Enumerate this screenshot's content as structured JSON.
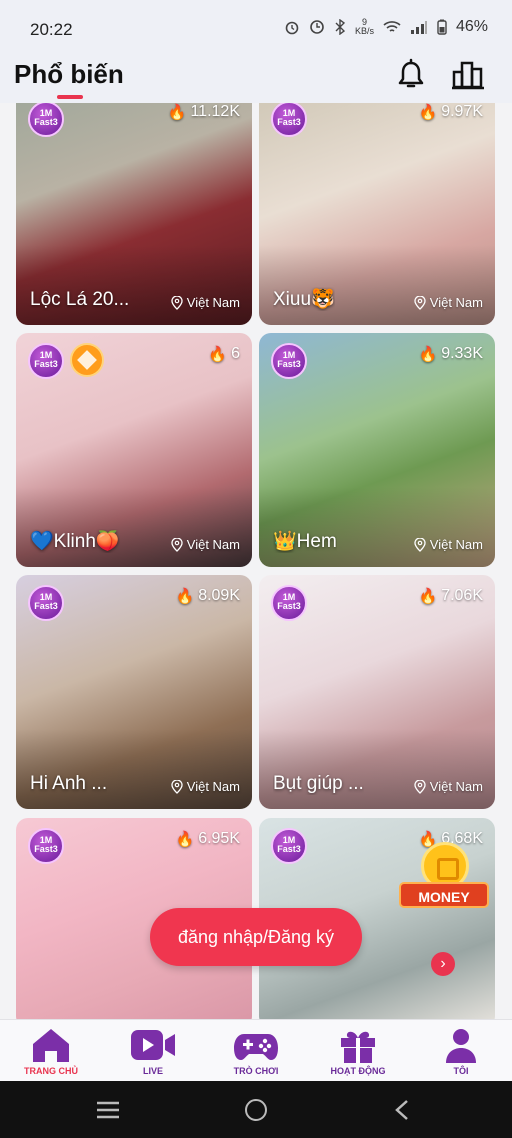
{
  "status_bar": {
    "time": "20:22",
    "net_speed": "9",
    "net_unit": "KB/s",
    "battery": "46%"
  },
  "header": {
    "title": "Phổ biến"
  },
  "cards": [
    {
      "views": "11.12K",
      "name": "Lộc Lá 20...",
      "location": "Việt Nam"
    },
    {
      "views": "9.97K",
      "name": "Xiuu🐯",
      "location": "Việt Nam"
    },
    {
      "views": "6",
      "name": "💙Klinh🍑",
      "location": "Việt Nam"
    },
    {
      "views": "9.33K",
      "name": "👑Hem",
      "location": "Việt Nam"
    },
    {
      "views": "8.09K",
      "name": "Hi Anh ...",
      "location": "Việt Nam"
    },
    {
      "views": "7.06K",
      "name": "Bụt giúp ...",
      "location": "Việt Nam"
    },
    {
      "views": "6.95K",
      "name": "",
      "location": ""
    },
    {
      "views": "6.68K",
      "name": "",
      "location": ""
    }
  ],
  "badge_text": {
    "line1": "1M",
    "line2": "Fast3"
  },
  "money_label": "MONEY",
  "login_button": "đăng nhập/Đăng ký",
  "bottom_nav": [
    {
      "label": "TRANG CHỦ",
      "icon": "home-icon",
      "active": true
    },
    {
      "label": "LIVE",
      "icon": "video-icon"
    },
    {
      "label": "TRÒ CHƠI",
      "icon": "gamepad-icon"
    },
    {
      "label": "HOẠT ĐỘNG",
      "icon": "gift-icon"
    },
    {
      "label": "TÔI",
      "icon": "person-icon"
    }
  ],
  "colors": {
    "accent": "#e9344f",
    "nav_purple": "#6a2a98"
  }
}
